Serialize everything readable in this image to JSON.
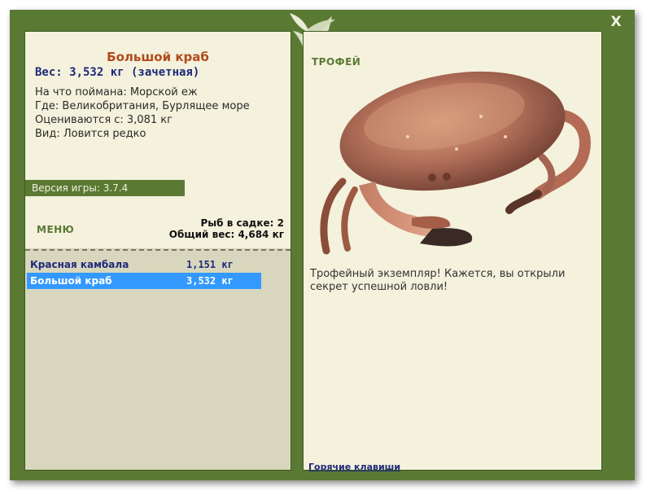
{
  "window": {
    "close_label": "X"
  },
  "fish": {
    "name": "Большой краб",
    "weight_line": "Вес: 3,532 кг (зачетная)",
    "bait_line": "На что поймана: Морской еж",
    "location_line": "Где: Великобритания, Бурлящее море",
    "value_line": "Оцениваются с: 3,081 кг",
    "type_line": "Вид: Ловится редко"
  },
  "version": {
    "label": "Версия игры: 3.7.4"
  },
  "menu": {
    "label": "МЕНЮ"
  },
  "keep": {
    "count_line": "Рыб в садке: 2",
    "total_line": "Общий вес: 4,684 кг"
  },
  "catch_list": [
    {
      "name": "Красная камбала",
      "weight": "1,151 кг",
      "selected": false
    },
    {
      "name": "Большой краб",
      "weight": "3,532 кг",
      "selected": true
    }
  ],
  "trophy": {
    "label": "ТРОФЕЙ",
    "text": "Трофейный экземпляр! Кажется, вы открыли секрет успешной ловли!",
    "image_icon": "crab-image"
  },
  "footer": {
    "hotkeys_label": "Горячие клавиши"
  },
  "colors": {
    "frame": "#5a7a34",
    "panel": "#f4f1dc",
    "panel_lower": "#d8d6bd",
    "title": "#b24a1a",
    "weight": "#1e2a7a",
    "selection": "#3399ff"
  }
}
